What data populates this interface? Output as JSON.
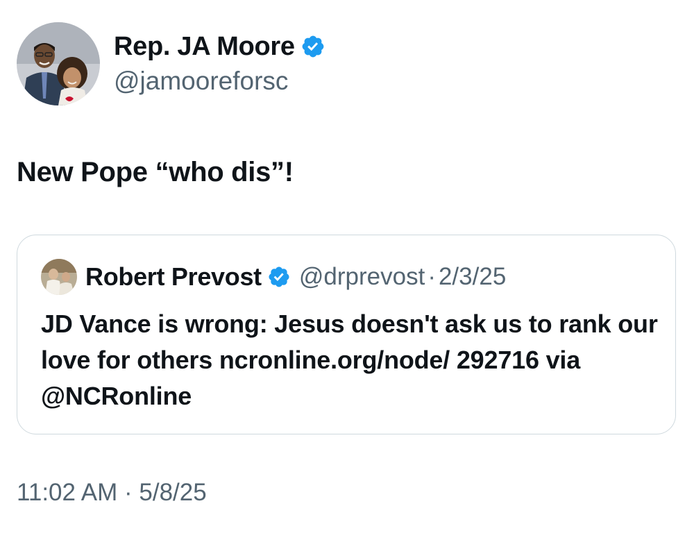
{
  "author": {
    "display_name": "Rep. JA Moore",
    "handle": "@jamooreforsc",
    "verified": true,
    "verified_color": "#1d9bf0",
    "avatar_icon": "profile-photo"
  },
  "tweet": {
    "text": "New Pope “who dis”!"
  },
  "quoted_tweet": {
    "display_name": "Robert Prevost",
    "handle": "@drprevost",
    "separator": "·",
    "date": "2/3/25",
    "verified": true,
    "avatar_icon": "profile-photo",
    "text": "JD Vance is wrong: Jesus doesn't ask us to rank our love for others ncronline.org/node/ 292716 via @NCRonline"
  },
  "meta": {
    "time": "11:02 AM",
    "separator": "·",
    "date": "5/8/25"
  },
  "colors": {
    "text": "#0f1419",
    "secondary_text": "#536471",
    "border": "#cfd9de",
    "verified_badge": "#1d9bf0"
  }
}
